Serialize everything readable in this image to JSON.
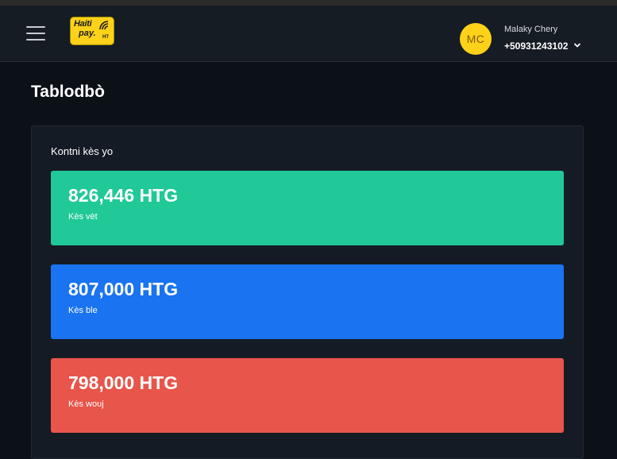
{
  "header": {
    "logo": {
      "line1": "Haiti",
      "line2": "pay.",
      "line3": "HT"
    },
    "user": {
      "initials": "MC",
      "name": "Malaky Chery",
      "phone": "+50931243102"
    }
  },
  "main": {
    "title": "Tablodbò",
    "accounts_panel": {
      "title": "Kontni kès yo",
      "cards": [
        {
          "amount": "826,446 HTG",
          "label": "Kès vèt",
          "color": "#20c997"
        },
        {
          "amount": "807,000 HTG",
          "label": "Kès ble",
          "color": "#1a73f0"
        },
        {
          "amount": "798,000 HTG",
          "label": "Kès wouj",
          "color": "#e8554a"
        }
      ]
    }
  },
  "icons": {
    "menu": "hamburger-menu-icon",
    "dropdown": "chevron-down-icon"
  }
}
